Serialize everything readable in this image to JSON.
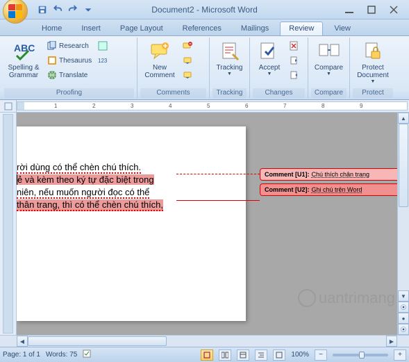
{
  "window": {
    "title": "Document2 - Microsoft Word"
  },
  "tabs": {
    "home": "Home",
    "insert": "Insert",
    "layout": "Page Layout",
    "references": "References",
    "mailings": "Mailings",
    "review": "Review",
    "view": "View"
  },
  "ribbon": {
    "proofing": {
      "label": "Proofing",
      "spelling": "Spelling &\nGrammar",
      "research": "Research",
      "thesaurus": "Thesaurus",
      "translate": "Translate"
    },
    "comments": {
      "label": "Comments",
      "new": "New\nComment"
    },
    "tracking": {
      "label": "Tracking",
      "btn": "Tracking"
    },
    "changes": {
      "label": "Changes",
      "accept": "Accept"
    },
    "compare": {
      "label": "Compare",
      "btn": "Compare"
    },
    "protect": {
      "label": "Protect",
      "btn": "Protect\nDocument"
    }
  },
  "document": {
    "lines": [
      "rời dùng có thể chèn chú thích.",
      "ẻ và kèm theo ký tự đặc biệt trong",
      "niên, nếu muốn người đọc có thể",
      "thân trang, thì có thể chèn chú thích,"
    ]
  },
  "comments": [
    {
      "label": "Comment [U1]:",
      "text": "Chú thích chân trang"
    },
    {
      "label": "Comment [U2]:",
      "text": "Ghi chú trên Word"
    }
  ],
  "statusbar": {
    "page": "Page: 1 of 1",
    "words": "Words: 75",
    "zoom": "100%"
  },
  "watermark": "uantrimang"
}
